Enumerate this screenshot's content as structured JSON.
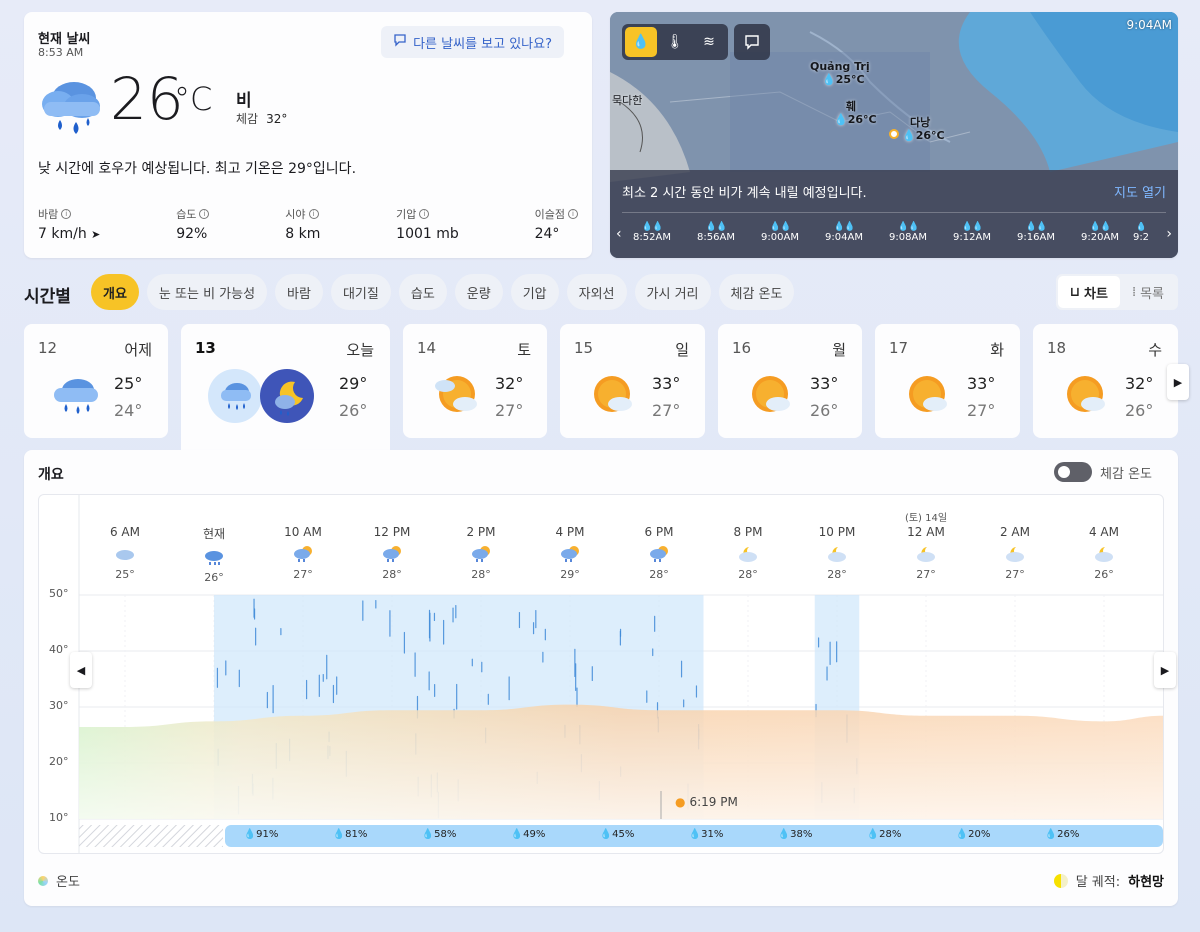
{
  "current": {
    "title": "현재 날씨",
    "time": "8:53 AM",
    "feedback": "다른 날씨를 보고 있나요?",
    "temp": "26",
    "unit": "°C",
    "condition": "비",
    "feels_label": "체감",
    "feels_value": "32°",
    "description": "낮 시간에 호우가 예상됩니다. 최고 기온은 29°입니다.",
    "stats": [
      {
        "label": "바람",
        "value": "7 km/h"
      },
      {
        "label": "습도",
        "value": "92%"
      },
      {
        "label": "시야",
        "value": "8 km"
      },
      {
        "label": "기압",
        "value": "1001 mb"
      },
      {
        "label": "이슬점",
        "value": "24°"
      }
    ]
  },
  "map": {
    "time": "9:04AM",
    "tools": [
      "precip-icon",
      "thermometer-icon",
      "wind-icon"
    ],
    "cities": [
      {
        "name": "Quảng Trị",
        "temp": "25°C"
      },
      {
        "name": "훼",
        "temp": "26°C"
      },
      {
        "name": "다낭",
        "temp": "26°C"
      },
      {
        "name": "묵다한",
        "temp": ""
      }
    ],
    "message": "최소 2 시간 동안 비가 계속 내릴 예정입니다.",
    "open_label": "지도 열기",
    "timeline": [
      "8:52AM",
      "8:56AM",
      "9:00AM",
      "9:04AM",
      "9:08AM",
      "9:12AM",
      "9:16AM",
      "9:20AM",
      "9:2"
    ]
  },
  "hourly": {
    "title": "시간별",
    "chips": [
      "개요",
      "눈 또는 비 가능성",
      "바람",
      "대기질",
      "습도",
      "운량",
      "기압",
      "자외선",
      "가시 거리",
      "체감 온도"
    ],
    "view_chart": "차트",
    "view_list": "목록"
  },
  "days": [
    {
      "date": "12",
      "name": "어제",
      "hi": "25°",
      "lo": "24°",
      "icon": "rain-icon"
    },
    {
      "date": "13",
      "name": "오늘",
      "hi": "29°",
      "lo": "26°",
      "icon": "rain-icon"
    },
    {
      "date": "14",
      "name": "토",
      "hi": "32°",
      "lo": "27°",
      "icon": "partly-sunny-icon"
    },
    {
      "date": "15",
      "name": "일",
      "hi": "33°",
      "lo": "27°",
      "icon": "partly-sunny-icon"
    },
    {
      "date": "16",
      "name": "월",
      "hi": "33°",
      "lo": "26°",
      "icon": "partly-sunny-icon"
    },
    {
      "date": "17",
      "name": "화",
      "hi": "33°",
      "lo": "27°",
      "icon": "partly-sunny-icon"
    },
    {
      "date": "18",
      "name": "수",
      "hi": "32°",
      "lo": "26°",
      "icon": "partly-sunny-icon"
    }
  ],
  "chart": {
    "title": "개요",
    "feels_toggle": "체감 온도",
    "legend_temp": "온도",
    "moon_label": "달 궤적:",
    "moon_phase": "하현망",
    "sunset": "6:19 PM",
    "next_day_label": "(토) 14일"
  },
  "chart_data": {
    "type": "area",
    "x": [
      "6 AM",
      "현재",
      "10 AM",
      "12 PM",
      "2 PM",
      "4 PM",
      "6 PM",
      "8 PM",
      "10 PM",
      "12 AM",
      "2 AM",
      "4 AM"
    ],
    "temps": [
      25,
      26,
      27,
      28,
      28,
      29,
      28,
      28,
      28,
      27,
      27,
      26
    ],
    "temp_labels": [
      "25°",
      "26°",
      "27°",
      "28°",
      "28°",
      "29°",
      "28°",
      "28°",
      "28°",
      "27°",
      "27°",
      "26°"
    ],
    "precip_labels": [
      "91%",
      "81%",
      "58%",
      "49%",
      "45%",
      "31%",
      "38%",
      "28%",
      "20%",
      "26%"
    ],
    "precip": [
      91,
      81,
      58,
      49,
      45,
      31,
      38,
      28,
      20,
      26
    ],
    "y_ticks": [
      "50°",
      "40°",
      "30°",
      "20°",
      "10°"
    ],
    "ylim": [
      10,
      50
    ]
  }
}
